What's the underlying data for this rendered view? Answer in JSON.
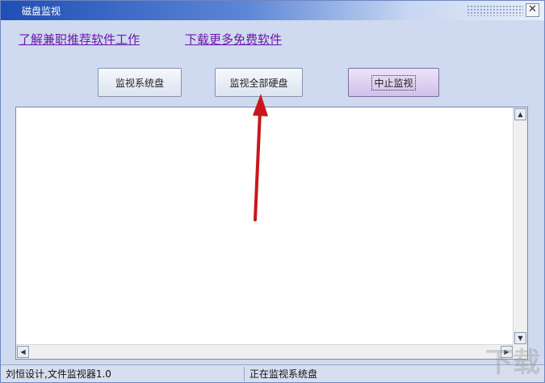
{
  "window": {
    "title": "磁盘监视",
    "close_glyph": "✕"
  },
  "links": {
    "link1": "了解兼职推荐软件工作",
    "link2": "下载更多免费软件"
  },
  "buttons": {
    "monitor_system": "监视系统盘",
    "monitor_all": "监视全部硬盘",
    "stop": "中止监视"
  },
  "scroll": {
    "up": "▲",
    "down": "▼",
    "left": "◀",
    "right": "▶"
  },
  "status": {
    "left": "刘恒设计,文件监视器1.0",
    "right": "正在监视系统盘"
  },
  "watermark": "下载",
  "colors": {
    "link": "#6b1aa8",
    "annotation_arrow": "#c8171d"
  }
}
